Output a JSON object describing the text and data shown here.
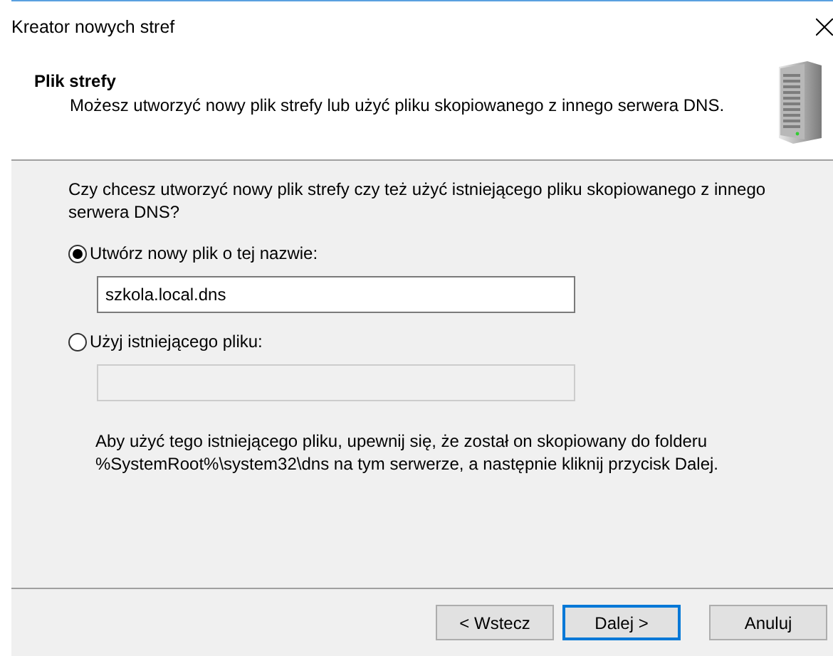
{
  "window": {
    "title": "Kreator nowych stref"
  },
  "header": {
    "title": "Plik strefy",
    "description": "Możesz utworzyć nowy plik strefy lub użyć pliku skopiowanego z innego serwera DNS."
  },
  "question": "Czy chcesz utworzyć nowy plik strefy czy też użyć istniejącego pliku skopiowanego z innego serwera DNS?",
  "options": [
    {
      "label": "Utwórz nowy plik o tej nazwie:",
      "selected": true,
      "field": {
        "value": "szkola.local.dns",
        "disabled": false
      }
    },
    {
      "label": "Użyj istniejącego pliku:",
      "selected": false,
      "field": {
        "disabled": true
      }
    }
  ],
  "note": "Aby użyć tego istniejącego pliku, upewnij się, że został on skopiowany do folderu %SystemRoot%\\system32\\dns na tym serwerze, a następnie kliknij przycisk Dalej.",
  "buttons": [
    {
      "label": "< Wstecz",
      "focused": false
    },
    {
      "label": "Dalej >",
      "focused": true
    },
    {
      "label": "Anuluj",
      "focused": false
    }
  ]
}
